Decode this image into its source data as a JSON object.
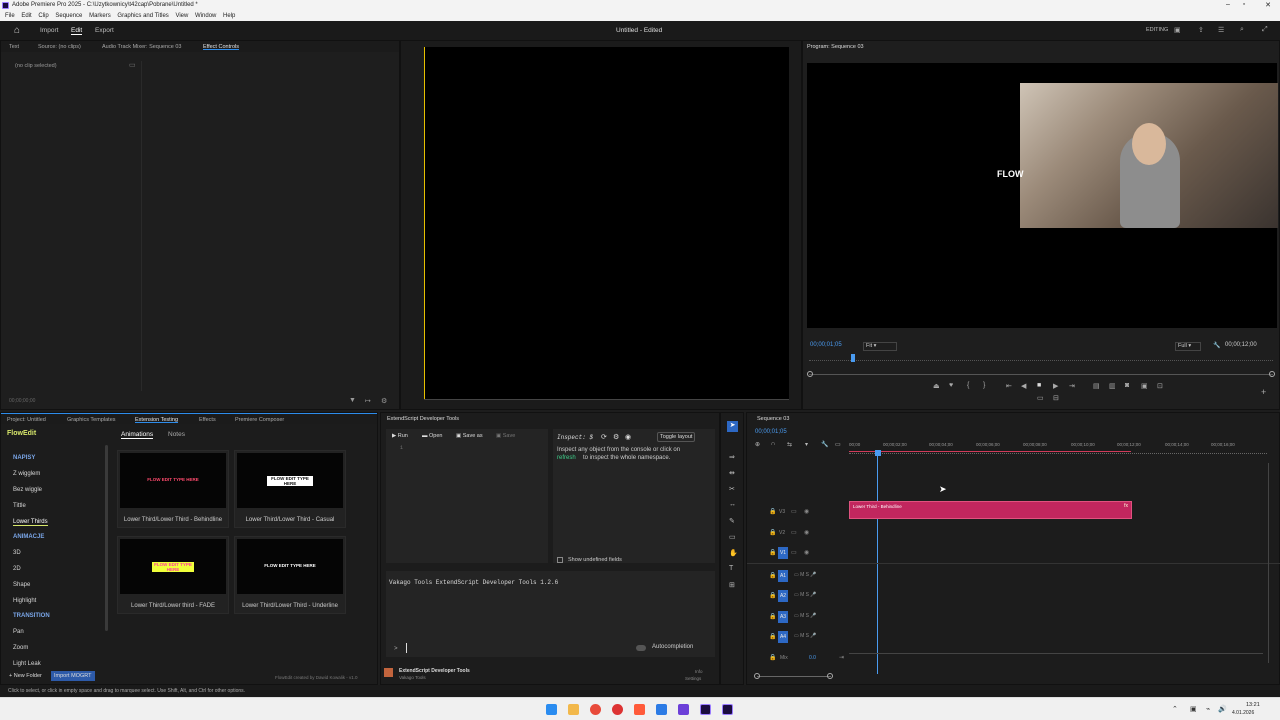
{
  "window": {
    "title": "Adobe Premiere Pro 2025 - C:\\Uzytkownicy\\t42cap\\Pobrane\\Untitled *"
  },
  "menu": [
    "File",
    "Edit",
    "Clip",
    "Sequence",
    "Markers",
    "Graphics and Titles",
    "View",
    "Window",
    "Help"
  ],
  "header": {
    "tabs": [
      "Import",
      "Edit",
      "Export"
    ],
    "active_tab": "Edit",
    "project_title": "Untitled - Edited",
    "workspace": "EDITING"
  },
  "source_panel": {
    "tabs": [
      "Text",
      "Source: (no clips)",
      "Audio Track Mixer: Sequence 03",
      "Effect Controls"
    ],
    "active": "Effect Controls",
    "no_clip": "(no clip selected)",
    "timecode": "00;00;00;00"
  },
  "program_monitor": {
    "title": "Program: Sequence 03",
    "overlay_text": "FLOW",
    "timecode": "00;00;01;05",
    "fit": "Fit",
    "quality": "Full",
    "duration": "00;00;12;00",
    "playhead_fraction": 0.09
  },
  "project_panel": {
    "tabs": [
      "Project: Untitled",
      "Graphics Templates",
      "Extension Testing",
      "Effects",
      "Premiere Composer"
    ],
    "active": "Extension Testing"
  },
  "flowedit": {
    "brand": "FlowEdit",
    "subtabs": [
      "Animations",
      "Notes"
    ],
    "active_subtab": "Animations",
    "sections": [
      {
        "heading": "NAPISY",
        "items": [
          "Z wigglem",
          "Bez wiggle",
          "Tittle",
          "Lower Thirds"
        ]
      },
      {
        "heading": "ANIMACJE",
        "items": [
          "3D",
          "2D",
          "Shape",
          "Highlight"
        ]
      },
      {
        "heading": "TRANSITION",
        "items": [
          "Pan",
          "Zoom",
          "Light Leak"
        ]
      }
    ],
    "active_item": "Lower Thirds",
    "cards": [
      {
        "title": "Lower Third/Lower Third - Behindline",
        "thumb_text": "FLOW EDIT TYPE HERE",
        "thumb_color": "#ff4a6d"
      },
      {
        "title": "Lower Third/Lower Third - Casual",
        "thumb_text": "FLOW EDIT TYPE HERE",
        "thumb_color": "#ffffff"
      },
      {
        "title": "Lower Third/Lower third - FADE",
        "thumb_text": "FLOW EDIT TYPE HERE",
        "thumb_color": "#f0ff3a"
      },
      {
        "title": "Lower Third/Lower Third - Underline",
        "thumb_text": "FLOW EDIT TYPE HERE",
        "thumb_color": "#ffffff"
      }
    ],
    "new_folder": "+ New Folder",
    "import_mogrt": "Import MOGRT",
    "credit": "FlowEdit created by Dawid Kowalik - v1.0"
  },
  "extendscript": {
    "panel_title": "ExtendScript Developer Tools",
    "buttons": [
      "Run",
      "Open",
      "Save as",
      "Save"
    ],
    "line_number": "1",
    "inspect_label": "Inspect: $",
    "toggle_layout": "Toggle layout",
    "inspect_help": "Inspect any object from the console or click on",
    "inspect_link": "refresh",
    "inspect_help2": "to inspect the whole namespace.",
    "show_undefined": "Show undefined fields",
    "console_text": "Vakago Tools ExtendScript Developer Tools 1.2.6",
    "prompt": ">",
    "autocompletion": "Autocompletion",
    "footer_name": "ExtendScript Developer Tools",
    "footer_sub": "Vakago Tools",
    "info": "Info",
    "settings": "Settings"
  },
  "timeline": {
    "title": "Sequence 03",
    "timecode": "00;00;01;05",
    "ruler": [
      "00;00",
      "00;00;02;00",
      "00;00;04;00",
      "00;00;06;00",
      "00;00;08;00",
      "00;00;10;00",
      "00;00;12;00",
      "00;00;14;00",
      "00;00;16;00"
    ],
    "video_tracks": [
      "V3",
      "V2",
      "V1"
    ],
    "audio_tracks": [
      "A1",
      "A2",
      "A3",
      "A4"
    ],
    "mix_label": "Mix",
    "mix_value": "0.0",
    "clip_label": "Lower Third - Behindline",
    "clip_color": "#c1265e"
  },
  "statusbar": {
    "hint": "Click to select, or click in empty space and drag to marquee select. Use Shift, Alt, and Ctrl for other options."
  },
  "taskbar": {
    "time": "13:21",
    "date": "4.01.2026"
  }
}
